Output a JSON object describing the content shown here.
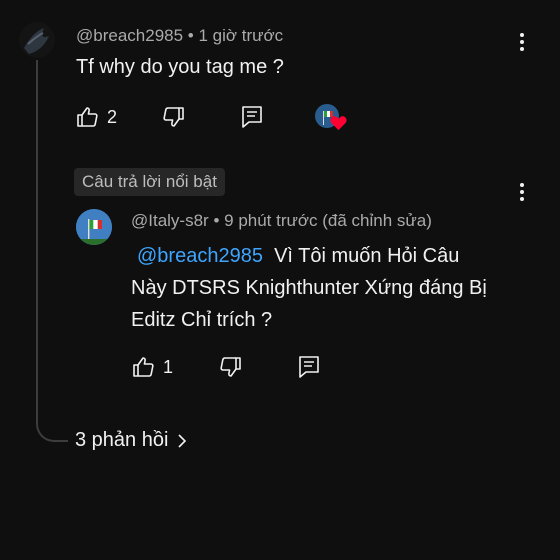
{
  "comment": {
    "author": "@breach2985",
    "sep": "•",
    "time": "1 giờ trước",
    "text": "Tf why do you tag me ?",
    "likes": "2"
  },
  "highlight_chip": "Câu trả lời nổi bật",
  "reply": {
    "author": "@Italy-s8r",
    "sep": "•",
    "time": "9 phút trước (đã chỉnh sửa)",
    "mention": "@breach2985",
    "line1": "Vì Tôi muốn Hỏi Câu",
    "line2": "Này DTSRS Knighthunter Xứng đáng Bị",
    "line3": "Editz Chỉ trích ?",
    "likes": "1"
  },
  "replies_link": "3 phản hồi",
  "icons": {
    "like": "thumb-up-icon",
    "dislike": "thumb-down-icon",
    "reply": "comment-icon",
    "more": "more-vert-icon",
    "chevron": "chevron-right-icon",
    "heart": "creator-heart-icon"
  },
  "colors": {
    "background": "#0f0f0f",
    "mention": "#3ea6ff",
    "heart": "#ff0033",
    "muted": "#aaaaaa"
  }
}
